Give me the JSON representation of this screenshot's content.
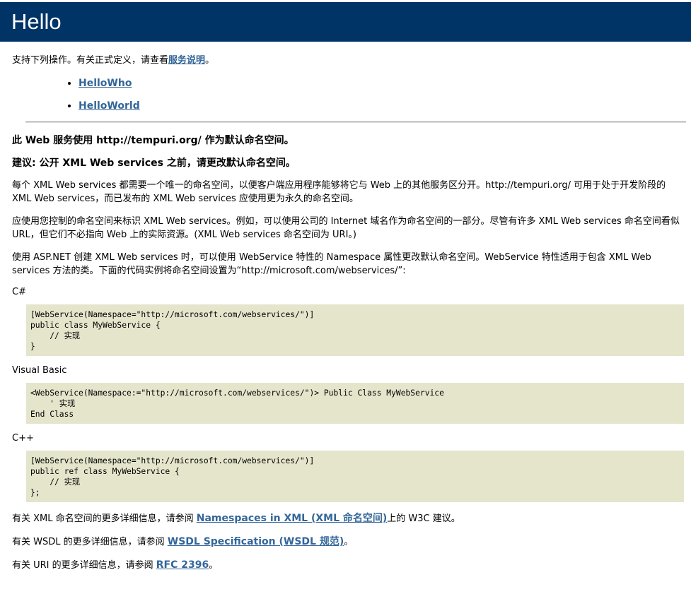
{
  "header": {
    "title": "Hello"
  },
  "intro": {
    "text": "支持下列操作。有关正式定义，请查看",
    "link": "服务说明",
    "end": "。"
  },
  "operations": [
    "HelloWho",
    "HelloWorld"
  ],
  "namespace_notice": "此 Web 服务使用 http://tempuri.org/ 作为默认命名空间。",
  "recommendation": "建议: 公开 XML Web services 之前，请更改默认命名空间。",
  "paragraphs": [
    "每个 XML Web services 都需要一个唯一的命名空间，以便客户端应用程序能够将它与 Web 上的其他服务区分开。http://tempuri.org/ 可用于处于开发阶段的 XML Web services，而已发布的 XML Web services 应使用更为永久的命名空间。",
    "应使用您控制的命名空间来标识 XML Web services。例如，可以使用公司的 Internet 域名作为命名空间的一部分。尽管有许多 XML Web services 命名空间看似 URL，但它们不必指向 Web 上的实际资源。(XML Web services 命名空间为 URI。)",
    "使用 ASP.NET 创建 XML Web services 时，可以使用 WebService 特性的 Namespace 属性更改默认命名空间。WebService 特性适用于包含 XML Web services 方法的类。下面的代码实例将命名空间设置为“http://microsoft.com/webservices/”:"
  ],
  "examples": [
    {
      "language": "C#",
      "code": "[WebService(Namespace=\"http://microsoft.com/webservices/\")]\npublic class MyWebService {\n    // 实现\n}"
    },
    {
      "language": "Visual Basic",
      "code": "<WebService(Namespace:=\"http://microsoft.com/webservices/\")> Public Class MyWebService\n    ' 实现\nEnd Class"
    },
    {
      "language": "C++",
      "code": "[WebService(Namespace=\"http://microsoft.com/webservices/\")]\npublic ref class MyWebService {\n    // 实现\n};"
    }
  ],
  "footer": [
    {
      "before": "有关 XML 命名空间的更多详细信息，请参阅 ",
      "link": "Namespaces in XML (XML 命名空间)",
      "after": "上的 W3C 建议。"
    },
    {
      "before": "有关 WSDL 的更多详细信息，请参阅 ",
      "link": "WSDL Specification (WSDL 规范)",
      "after": "。"
    },
    {
      "before": "有关 URI 的更多详细信息，请参阅 ",
      "link": "RFC 2396",
      "after": "。"
    }
  ]
}
